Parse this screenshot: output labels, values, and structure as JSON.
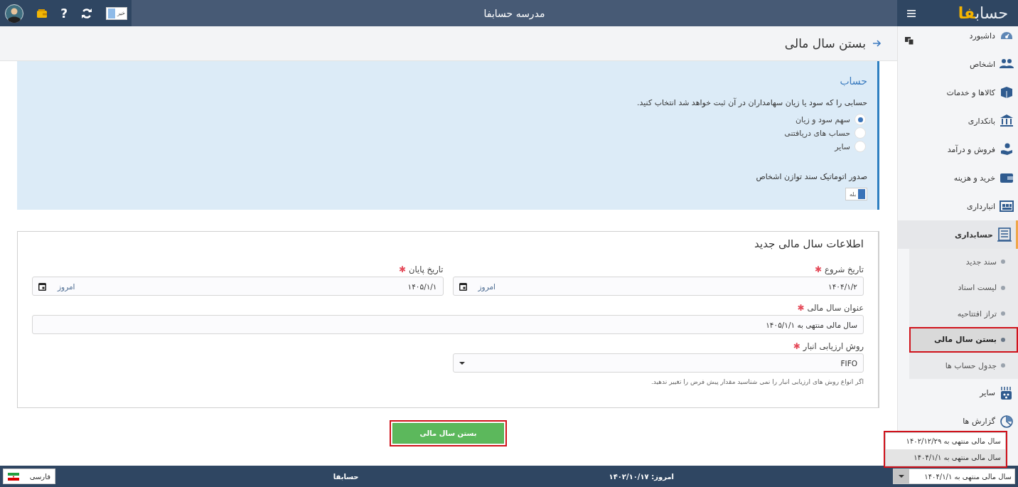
{
  "topbar": {
    "logo": {
      "main": "حساب",
      "accent": "فا"
    },
    "title": "مدرسه حسابفا",
    "toggle": {
      "label": "خیر",
      "on": false
    },
    "help": "?"
  },
  "sidebar": {
    "items": [
      {
        "label": "داشبورد",
        "selected": false
      },
      {
        "label": "اشخاص",
        "selected": false
      },
      {
        "label": "کالاها و خدمات",
        "selected": false
      },
      {
        "label": "بانکداری",
        "selected": false
      },
      {
        "label": "فروش و درآمد",
        "selected": false
      },
      {
        "label": "خرید و هزینه",
        "selected": false
      },
      {
        "label": "انبارداری",
        "selected": false
      },
      {
        "label": "حسابداری",
        "selected": true,
        "expanded": true,
        "children": [
          {
            "label": "سند جدید",
            "selected": false,
            "highlighted": false
          },
          {
            "label": "لیست اسناد",
            "selected": false,
            "highlighted": false
          },
          {
            "label": "تراز افتتاحیه",
            "selected": false,
            "highlighted": false
          },
          {
            "label": "بستن سال مالی",
            "selected": true,
            "highlighted": true
          },
          {
            "label": "جدول حساب ها",
            "selected": false,
            "highlighted": false
          }
        ]
      },
      {
        "label": "سایر",
        "selected": false
      },
      {
        "label": "گزارش ها",
        "selected": false
      }
    ]
  },
  "page": {
    "title": "بستن سال مالی"
  },
  "account_panel": {
    "heading": "حساب",
    "instruction": "حسابی را که سود یا زیان سهامداران در آن ثبت خواهد شد انتخاب کنید.",
    "options": [
      {
        "label": "سهم سود و زیان",
        "selected": true
      },
      {
        "label": "حساب های دریافتنی",
        "selected": false
      },
      {
        "label": "سایر",
        "selected": false
      }
    ],
    "auto_label": "صدور اتوماتیک سند توازن اشخاص",
    "auto_toggle": {
      "label": "بله",
      "on": true
    }
  },
  "new_year": {
    "heading": "اطلاعات سال مالی جدید",
    "fields": [
      {
        "kind": "date",
        "label": "تاریخ شروع",
        "required_mark": "✱",
        "value": "۱۴۰۴/۱/۲",
        "today": "امروز"
      },
      {
        "kind": "date",
        "label": "تاریخ پایان",
        "required_mark": "✱",
        "value": "۱۴۰۵/۱/۱",
        "today": "امروز"
      },
      {
        "kind": "text",
        "label": "عنوان سال مالی",
        "required_mark": "✱",
        "value": "سال مالی منتهی به ۱۴۰۵/۱/۱"
      },
      {
        "kind": "select",
        "label": "روش ارزیابی انبار",
        "required_mark": "✱",
        "value": "FIFO",
        "hint": "اگر انواع روش های ارزیابی انبار را نمی شناسید مقدار پیش فرض را تغییر ندهید."
      }
    ]
  },
  "submit": {
    "label": "بستن سال مالی",
    "highlighted": true
  },
  "status_bar": {
    "language": "فارسی",
    "brand": "حسابفا",
    "today": "امروز: ۱۴۰۲/۱۰/۱۷",
    "year_select": {
      "value": "سال مالی منتهی به ۱۴۰۴/۱/۱",
      "expanded": true,
      "highlighted": true,
      "options": [
        {
          "label": "سال مالی منتهی به ۱۴۰۲/۱۲/۲۹",
          "selected": false
        },
        {
          "label": "سال مالی منتهی به ۱۴۰۴/۱/۱",
          "selected": true
        }
      ]
    }
  }
}
